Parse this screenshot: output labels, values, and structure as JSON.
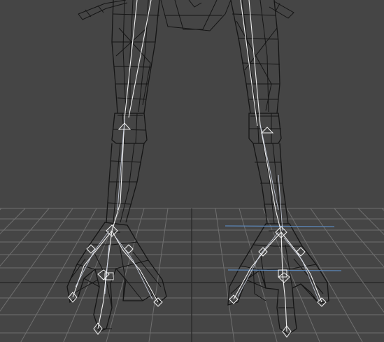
{
  "viewport": {
    "background": "#454545",
    "grid_color": "#6f6f6f",
    "grid_major_color": "#2a2a2a",
    "wireframe_color": "#151515",
    "bone_color": "#f0f0f0",
    "selection_color": "#5b86b8"
  }
}
